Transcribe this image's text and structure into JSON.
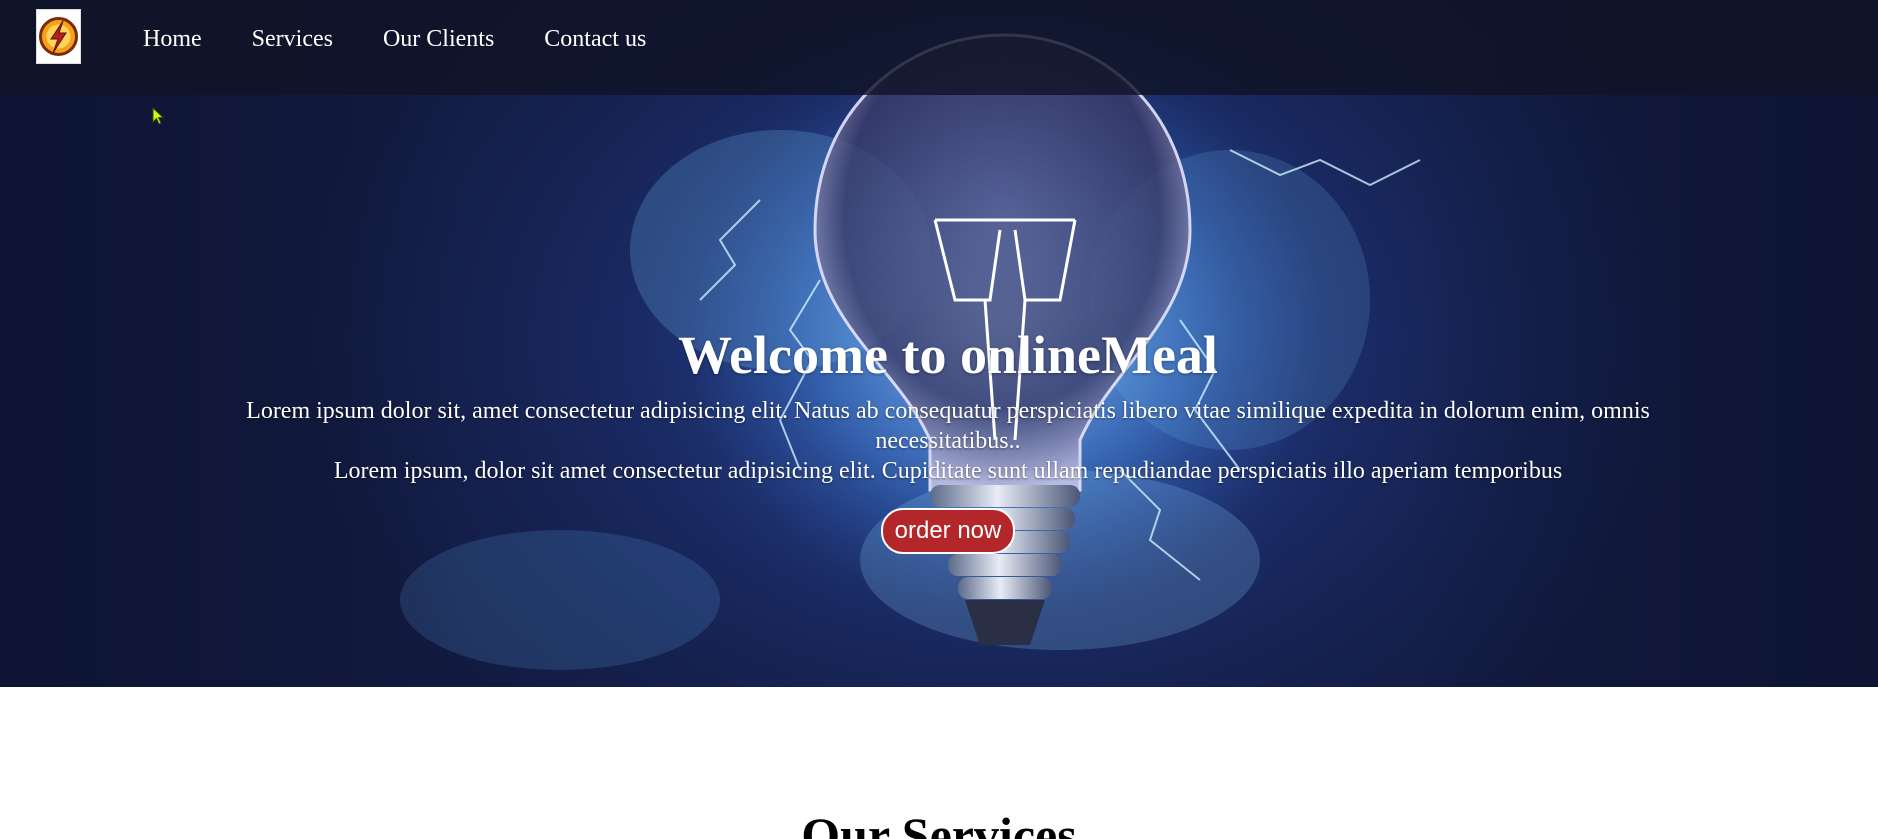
{
  "nav": {
    "logo_icon": "lightning-bolt-logo",
    "links": [
      {
        "label": "Home"
      },
      {
        "label": "Services"
      },
      {
        "label": "Our Clients"
      },
      {
        "label": "Contact us"
      }
    ]
  },
  "hero": {
    "title": "Welcome to onlineMeal",
    "paragraph_1": "Lorem ipsum dolor sit, amet consectetur adipisicing elit. Natus ab consequatur perspiciatis libero vitae similique expedita in dolorum enim, omnis necessitatibus..",
    "paragraph_2": "Lorem ipsum, dolor sit amet consectetur adipisicing elit. Cupiditate sunt ullam repudiandae perspiciatis illo aperiam temporibus",
    "button_label": "order now",
    "background_icon": "light-bulb-image"
  },
  "services": {
    "title": "Our Services"
  },
  "colors": {
    "navbar_bg": "#101426",
    "hero_bg": "#1b2c68",
    "button_bg": "#b3272a",
    "text": "#ffffff"
  }
}
